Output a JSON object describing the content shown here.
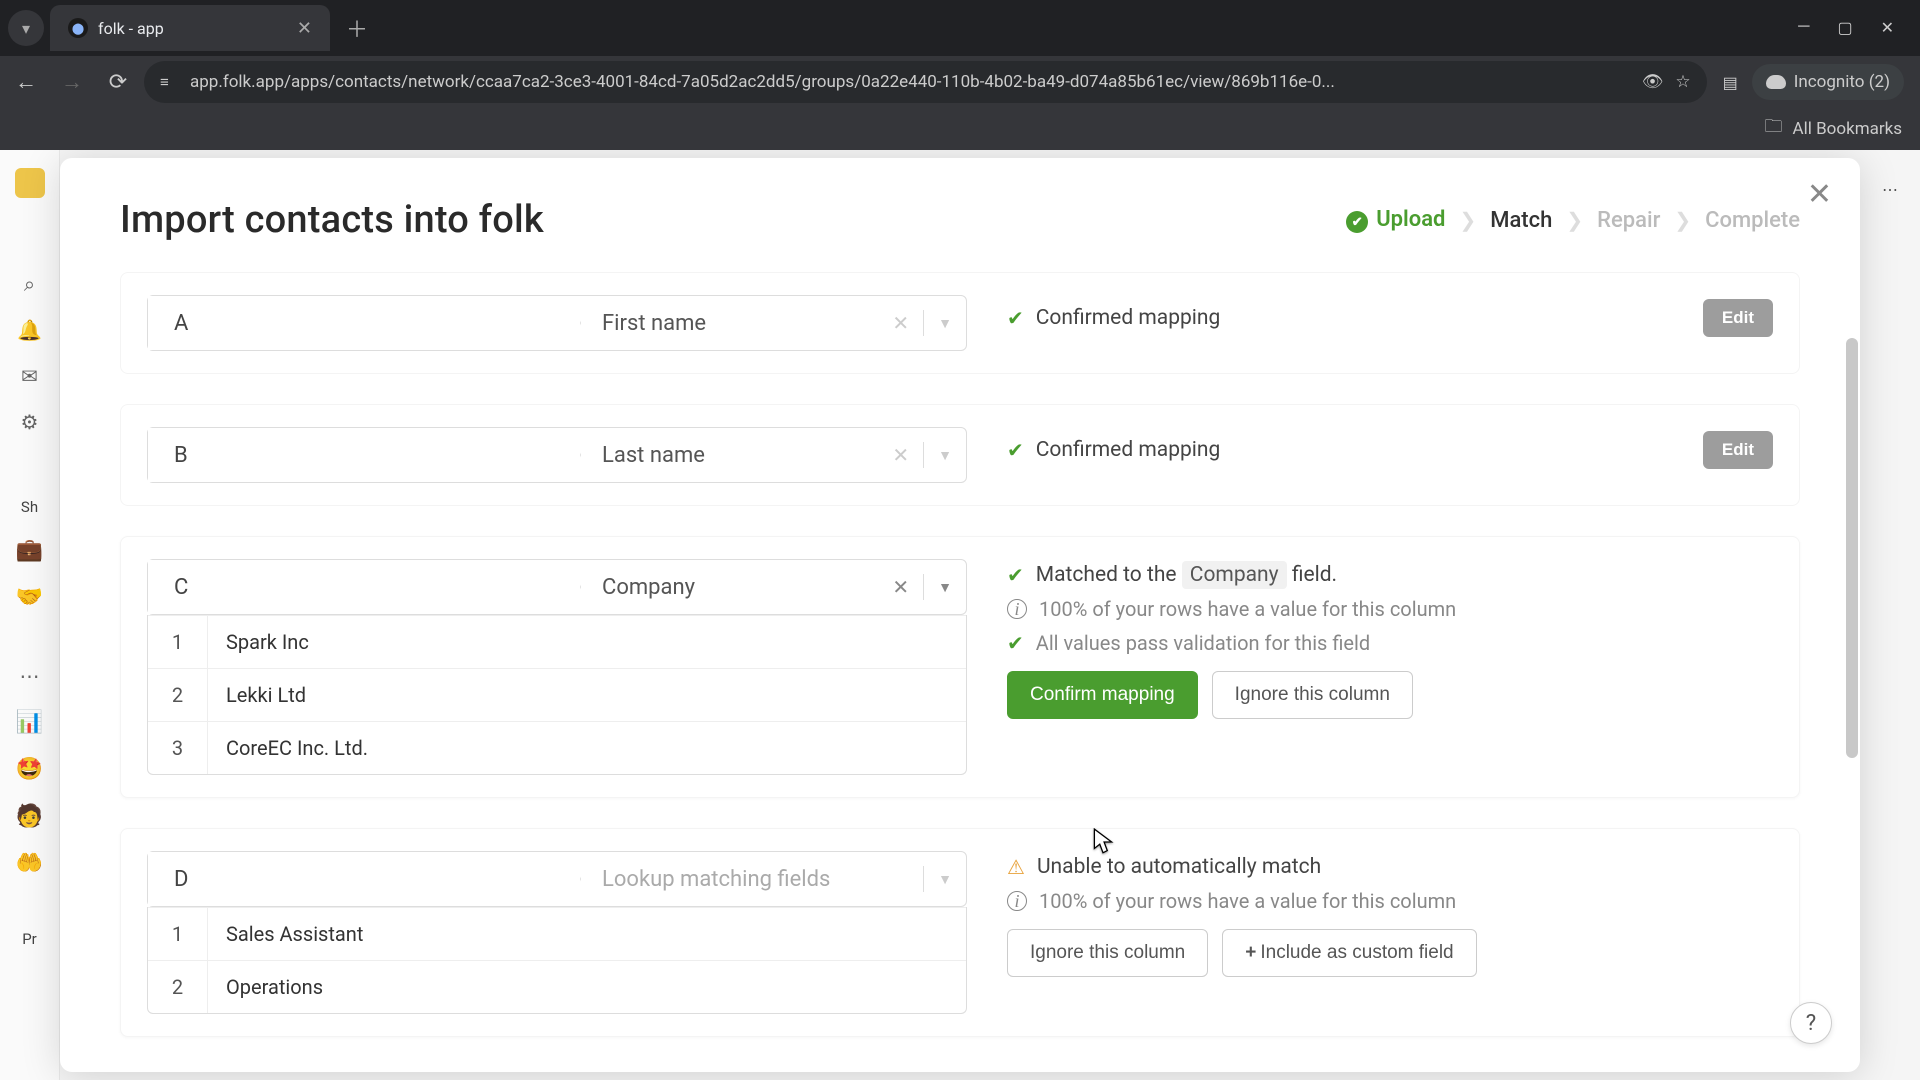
{
  "browser": {
    "tab_title": "folk - app",
    "url": "app.folk.app/apps/contacts/network/ccaa7ca2-3ce3-4001-84cd-7a05d2ac2dd5/groups/0a22e440-110b-4b02-ba49-d074a85b61ec/view/869b116e-0...",
    "incognito_label": "Incognito (2)",
    "bookmarks_label": "All Bookmarks"
  },
  "bg_sidebar": {
    "shared_label": "Sh",
    "private_label": "Pr"
  },
  "modal": {
    "title": "Import contacts into folk",
    "steps": {
      "upload": "Upload",
      "match": "Match",
      "repair": "Repair",
      "complete": "Complete"
    }
  },
  "columns": [
    {
      "letter": "A",
      "field": "First name",
      "state": "confirmed",
      "confirmed_text": "Confirmed mapping",
      "edit_label": "Edit",
      "rows": []
    },
    {
      "letter": "B",
      "field": "Last name",
      "state": "confirmed",
      "confirmed_text": "Confirmed mapping",
      "edit_label": "Edit",
      "rows": []
    },
    {
      "letter": "C",
      "field": "Company",
      "state": "matched",
      "matched_prefix": "Matched to the",
      "matched_pill": "Company",
      "matched_suffix": "field.",
      "rows_info": "100% of your rows have a value for this column",
      "validation": "All values pass validation for this field",
      "confirm_label": "Confirm mapping",
      "ignore_label": "Ignore this column",
      "rows": [
        {
          "idx": "1",
          "val": "Spark Inc"
        },
        {
          "idx": "2",
          "val": "Lekki Ltd"
        },
        {
          "idx": "3",
          "val": "CoreEC Inc. Ltd."
        }
      ]
    },
    {
      "letter": "D",
      "field_placeholder": "Lookup matching fields",
      "state": "unmatched",
      "unmatched_text": "Unable to automatically match",
      "rows_info": "100% of your rows have a value for this column",
      "ignore_label": "Ignore this column",
      "custom_label": "Include as custom field",
      "rows": [
        {
          "idx": "1",
          "val": "Sales Assistant"
        },
        {
          "idx": "2",
          "val": "Operations"
        }
      ]
    }
  ],
  "help_label": "?"
}
